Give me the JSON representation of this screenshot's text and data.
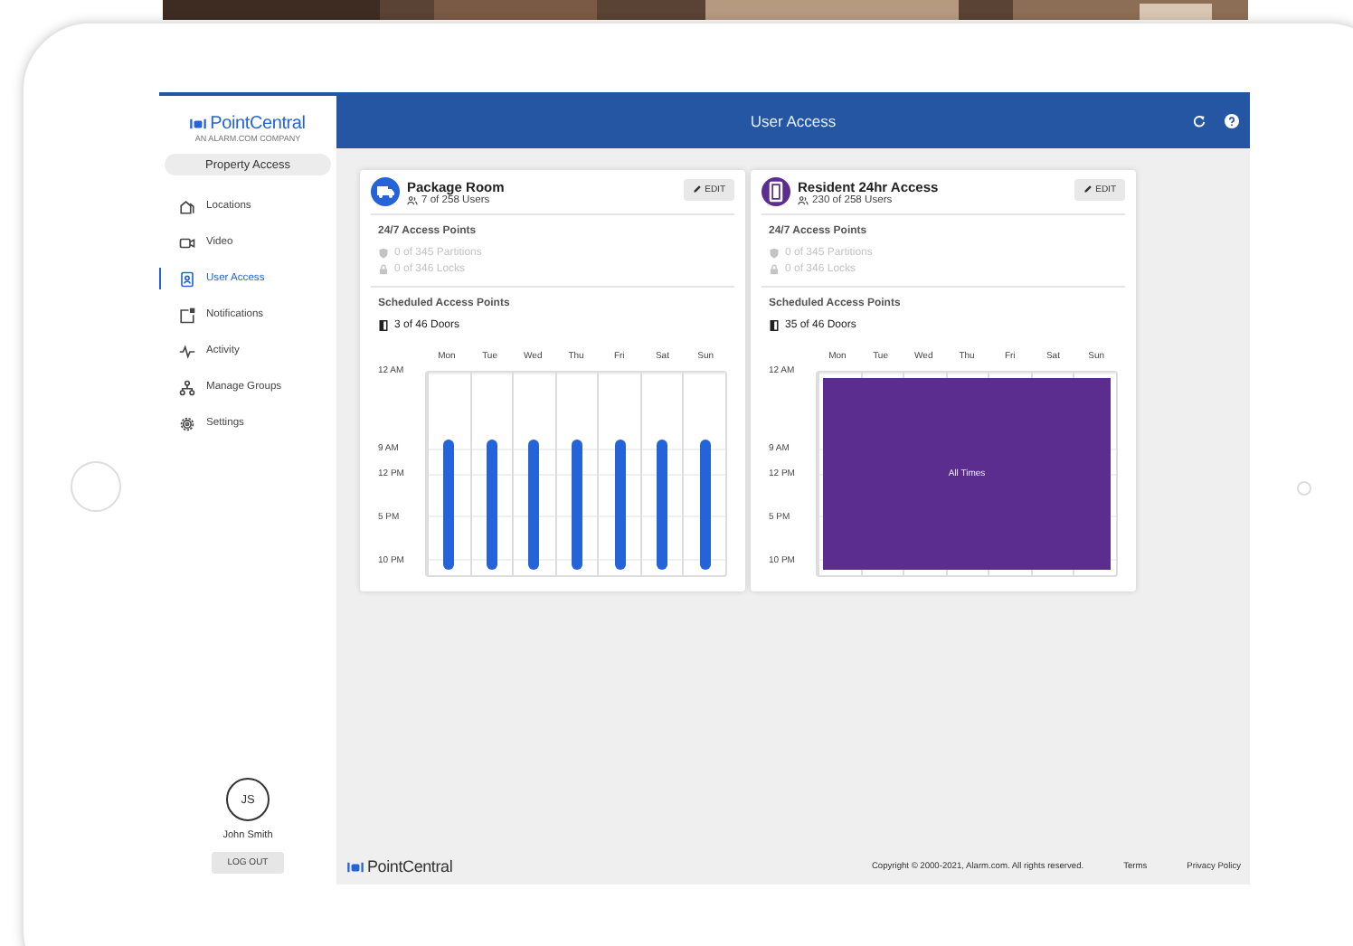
{
  "sidebar": {
    "logo": "PointCentral",
    "logo_tagline": "AN ALARM.COM COMPANY",
    "property_button": "Property Access",
    "items": [
      {
        "label": "Locations",
        "selected": false
      },
      {
        "label": "Video",
        "selected": false
      },
      {
        "label": "User Access",
        "selected": true
      },
      {
        "label": "Notifications",
        "selected": false
      },
      {
        "label": "Activity",
        "selected": false
      },
      {
        "label": "Manage Groups",
        "selected": false
      },
      {
        "label": "Settings",
        "selected": false
      }
    ],
    "user": {
      "initials": "JS",
      "name": "John Smith"
    },
    "logout": "LOG OUT"
  },
  "header": {
    "title": "User Access"
  },
  "groups": [
    {
      "name": "Package Room",
      "color": "#2563d8",
      "users": "7 of 258 Users",
      "edit": "EDIT",
      "always_title": "24/7 Access Points",
      "always": [
        {
          "text": "0 of 345 Partitions",
          "disabled": true
        },
        {
          "text": "0 of 346 Locks",
          "disabled": true
        }
      ],
      "scheduled_title": "Scheduled Access Points",
      "doors": "3 of 46 Doors",
      "schedule": {
        "kind": "daily",
        "days": [
          "Mon",
          "Tue",
          "Wed",
          "Thu",
          "Fri",
          "Sat",
          "Sun"
        ],
        "times": [
          "12 AM",
          "9 AM",
          "12 PM",
          "5 PM",
          "10 PM"
        ]
      }
    },
    {
      "name": "Resident 24hr Access",
      "color": "#5b2d8e",
      "users": "230 of 258 Users",
      "edit": "EDIT",
      "always_title": "24/7 Access Points",
      "always": [
        {
          "text": "0 of 345 Partitions",
          "disabled": true
        },
        {
          "text": "0 of 346 Locks",
          "disabled": true
        }
      ],
      "scheduled_title": "Scheduled Access Points",
      "doors": "35 of 46 Doors",
      "schedule": {
        "kind": "all",
        "label": "All Times",
        "days": [
          "Mon",
          "Tue",
          "Wed",
          "Thu",
          "Fri",
          "Sat",
          "Sun"
        ],
        "times": [
          "12 AM",
          "9 AM",
          "12 PM",
          "5 PM",
          "10 PM"
        ]
      }
    }
  ],
  "footer": {
    "logo": "PointCentral",
    "copyright": "Copyright © 2000-2021, Alarm.com. All rights reserved.",
    "links": [
      "Terms",
      "Privacy Policy"
    ]
  }
}
